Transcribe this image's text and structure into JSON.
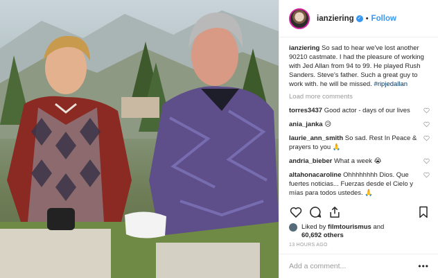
{
  "post": {
    "username": "ianziering",
    "follow_label": "Follow",
    "caption_user": "ianziering",
    "caption_text": "So sad to hear we've lost another 90210 castmate. I had the pleasure of working with Jed Allan from 94 to 99. He played Rush Sanders. Steve's father. Such a great guy to work with. he will be missed.",
    "hashtag": "#ripjedallan",
    "load_more": "Load more comments"
  },
  "comments": [
    {
      "user": "torres3437",
      "text": "Good actor - days of our lives"
    },
    {
      "user": "ania_janka",
      "text": "😥"
    },
    {
      "user": "laurie_ann_smith",
      "text": "So sad. Rest In Peace & prayers to you 🙏"
    },
    {
      "user": "andria_bieber",
      "text": "What a week 😭"
    },
    {
      "user": "altahonacaroline",
      "text": "Ohhhhhhhh Dios. Que fuertes noticias... Fuerzas desde el Cielo y mías para todos ustedes. 🙏"
    }
  ],
  "likes": {
    "prefix": "Liked by",
    "user": "filmtourismus",
    "and": "and",
    "count": "60,692 others"
  },
  "timestamp": "13 HOURS AGO",
  "add_comment": {
    "placeholder": "Add a comment..."
  },
  "colors": {
    "accent": "#3897f0",
    "text": "#262626",
    "muted": "#999999"
  },
  "icons": [
    "heart-icon",
    "comment-icon",
    "share-icon",
    "bookmark-icon",
    "more-icon",
    "verified-icon"
  ]
}
